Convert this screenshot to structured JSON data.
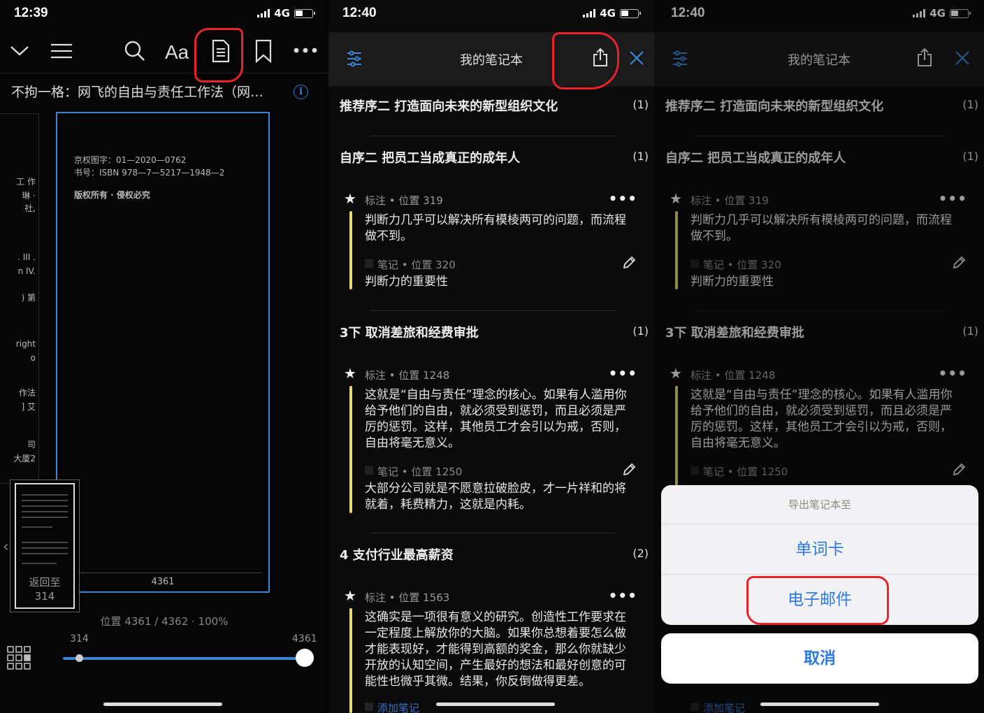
{
  "status_bars": [
    {
      "time": "12:39",
      "network": "4G"
    },
    {
      "time": "12:40",
      "network": "4G"
    },
    {
      "time": "12:40",
      "network": "4G"
    }
  ],
  "reader": {
    "book_title": "不拘一格：网飞的自由与责任工作法（网…",
    "info_icon": "i",
    "page_lines": [
      "京权图字：01—2020—0762",
      "书号：ISBN 978—7—5217—1948—2",
      "版权所有 · 侵权必究"
    ],
    "side_fragments": [
      "工 作",
      "琳 ·",
      "社,",
      ". III .",
      "n IV.",
      ") 第",
      "right",
      "o",
      "作法",
      "] 艾",
      "司",
      "大厦2"
    ],
    "page_number": "4361",
    "back_to_label": "返回至",
    "back_to_page": "314",
    "location_text": "位置 4361 / 4362 · 100%",
    "slider_min": "314",
    "slider_max": "4361",
    "progress": 1.0
  },
  "notebook": {
    "title": "我的笔记本",
    "sections": [
      {
        "title": "推荐序二 打造面向未来的新型组织文化",
        "count": "(1)"
      },
      {
        "title": "自序二 把员工当成真正的成年人",
        "count": "(1)"
      },
      {
        "title": "3下 取消差旅和经费审批",
        "count": "(1)"
      },
      {
        "title": "4 支付行业最高薪资",
        "count": "(2)"
      }
    ],
    "cards": [
      {
        "meta": "标注 • 位置 319",
        "text": "判断力几乎可以解决所有模棱两可的问题，而流程做不到。",
        "note_meta": "笔记 • 位置 320",
        "note": "判断力的重要性"
      },
      {
        "meta": "标注 • 位置 1248",
        "text": "这就是“自由与责任”理念的核心。如果有人滥用你给予他们的自由，就必须受到惩罚，而且必须是严厉的惩罚。这样，其他员工才会引以为戒，否则，自由将毫无意义。",
        "note_meta": "笔记 • 位置 1250",
        "note": "大部分公司就是不愿意拉破脸皮，才一片祥和的将就着，耗费精力，这就是内耗。"
      },
      {
        "meta": "标注 • 位置 1563",
        "text": "这确实是一项很有意义的研究。创造性工作要求在一定程度上解放你的大脑。如果你总想着要怎么做才能表现好，才能得到高额的奖金，那么你就缺少开放的认知空间，产生最好的想法和最好创意的可能性也微乎其微。结果，你反倒做得更差。",
        "add_note": "添加笔记"
      }
    ],
    "more_icon": "•••"
  },
  "export_sheet": {
    "title": "导出笔记本至",
    "options": [
      "单词卡",
      "电子邮件"
    ],
    "cancel": "取消"
  },
  "colors": {
    "accent": "#3a86d6",
    "highlight": "#e8d87a",
    "sheet_blue": "#2c7be5",
    "annotation_red": "#e8242a"
  }
}
